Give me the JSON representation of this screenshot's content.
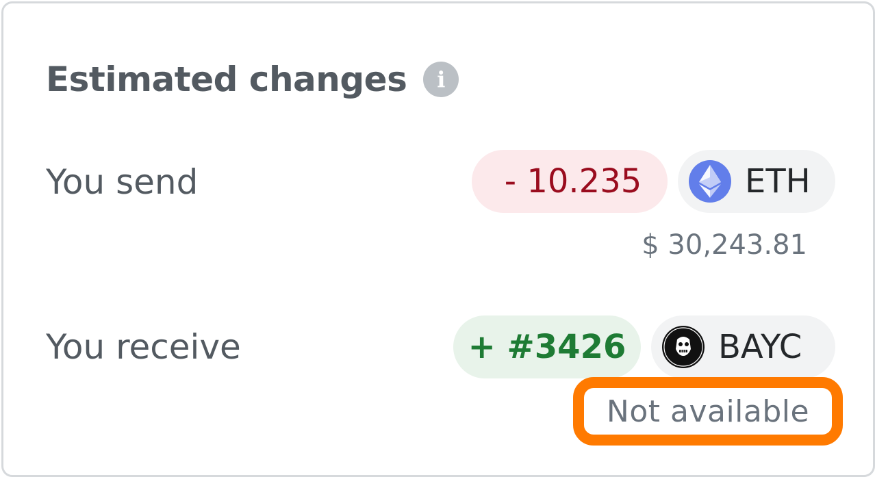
{
  "header": {
    "title": "Estimated changes",
    "info_icon_glyph": "i",
    "info_icon": "info-icon"
  },
  "send": {
    "label": "You send",
    "amount": "- 10.235",
    "token_symbol": "ETH",
    "token_icon": "ethereum-icon",
    "fiat_value": "$ 30,243.81"
  },
  "receive": {
    "label": "You receive",
    "amount": "+ #3426",
    "token_symbol": "BAYC",
    "token_icon": "bayc-icon",
    "fiat_value": "Not available"
  },
  "colors": {
    "send_amount_bg": "#fce9eb",
    "send_amount_text": "#9a0c1e",
    "receive_amount_bg": "#e8f3ea",
    "receive_amount_text": "#1e7b34",
    "highlight": "#ff7a00"
  }
}
